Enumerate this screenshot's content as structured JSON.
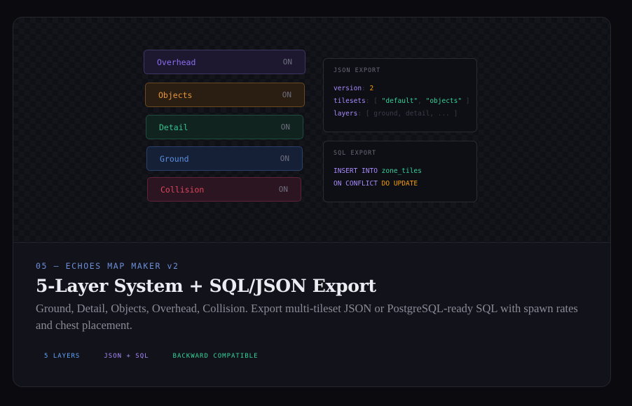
{
  "layers": [
    {
      "name": "Overhead",
      "state": "ON"
    },
    {
      "name": "Objects",
      "state": "ON"
    },
    {
      "name": "Detail",
      "state": "ON"
    },
    {
      "name": "Ground",
      "state": "ON"
    },
    {
      "name": "Collision",
      "state": "ON"
    }
  ],
  "json_export": {
    "title": "JSON EXPORT",
    "version_key": "version",
    "version_value": "2",
    "tilesets_key": "tilesets",
    "tileset_1": "\"default\"",
    "tileset_2": "\"objects\"",
    "layers_key": "layers",
    "layers_value": "[ ground, detail, ... ]"
  },
  "sql_export": {
    "title": "SQL EXPORT",
    "insert_kw": "INSERT INTO",
    "table": "zone_tiles",
    "conflict_kw": "ON CONFLICT",
    "update_kw": "DO UPDATE"
  },
  "info": {
    "eyebrow": "05 — ECHOES MAP MAKER v2",
    "title": "5-Layer System + SQL/JSON Export",
    "description": "Ground, Detail, Objects, Overhead, Collision. Export multi-tileset JSON or PostgreSQL-ready SQL with spawn rates and chest placement."
  },
  "tags": [
    "5 LAYERS",
    "JSON + SQL",
    "BACKWARD COMPATIBLE"
  ],
  "colors": {
    "overhead": "#8b6cf0",
    "objects": "#e8953a",
    "detail": "#36c28e",
    "ground": "#5b8ee0",
    "collision": "#e0455f"
  }
}
